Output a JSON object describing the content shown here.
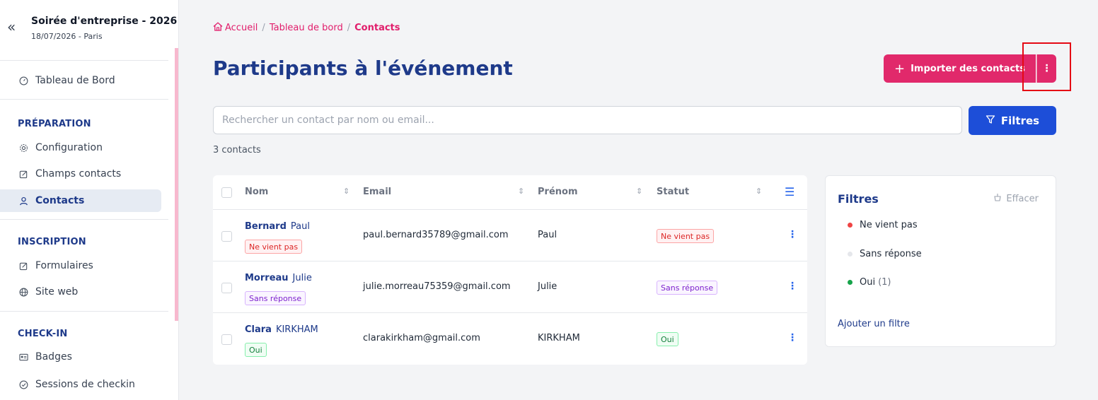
{
  "event": {
    "title": "Soirée d'entreprise - 2026",
    "subtitle": "18/07/2026 - Paris"
  },
  "sidebar": {
    "dashboard": "Tableau de Bord",
    "sections": [
      {
        "title": "PRÉPARATION",
        "items": [
          "Configuration",
          "Champs contacts",
          "Contacts"
        ]
      },
      {
        "title": "INSCRIPTION",
        "items": [
          "Formulaires",
          "Site web"
        ]
      },
      {
        "title": "CHECK-IN",
        "items": [
          "Badges",
          "Sessions de checkin"
        ]
      }
    ],
    "active_item": "Contacts"
  },
  "breadcrumb": {
    "home": "Accueil",
    "dashboard": "Tableau de bord",
    "current": "Contacts"
  },
  "page": {
    "title": "Participants à l'événement",
    "import_label": "Importer des contacts",
    "more_label": "⋮"
  },
  "search": {
    "placeholder": "Rechercher un contact par nom ou email..."
  },
  "filter_button": {
    "label": "Filtres"
  },
  "count": "3 contacts",
  "table": {
    "headers": {
      "nom": "Nom",
      "email": "Email",
      "prenom": "Prénom",
      "statut": "Statut"
    },
    "rows": [
      {
        "last": "Bernard",
        "first": "Paul",
        "tag": "Ne vient pas",
        "email": "paul.bernard35789@gmail.com",
        "prenom": "Paul",
        "statut": "Ne vient pas"
      },
      {
        "last": "Morreau",
        "first": "Julie",
        "tag": "Sans réponse",
        "email": "julie.morreau75359@gmail.com",
        "prenom": "Julie",
        "statut": "Sans réponse"
      },
      {
        "last": "Clara",
        "first": "KIRKHAM",
        "tag": "Oui",
        "email": "clarakirkham@gmail.com",
        "prenom": "KIRKHAM",
        "statut": "Oui"
      }
    ]
  },
  "filters_panel": {
    "title": "Filtres",
    "clear": "Effacer",
    "items": [
      {
        "label": "Ne vient pas",
        "count": "",
        "color": "#ef4444"
      },
      {
        "label": "Sans réponse",
        "count": "",
        "color": "#e5e7eb"
      },
      {
        "label": "Oui",
        "count": "(1)",
        "color": "#16a34a"
      }
    ],
    "add": "Ajouter un filtre"
  },
  "colors": {
    "accent": "#e1296b",
    "primary": "#1d4ed8",
    "title": "#1e3a8a"
  }
}
